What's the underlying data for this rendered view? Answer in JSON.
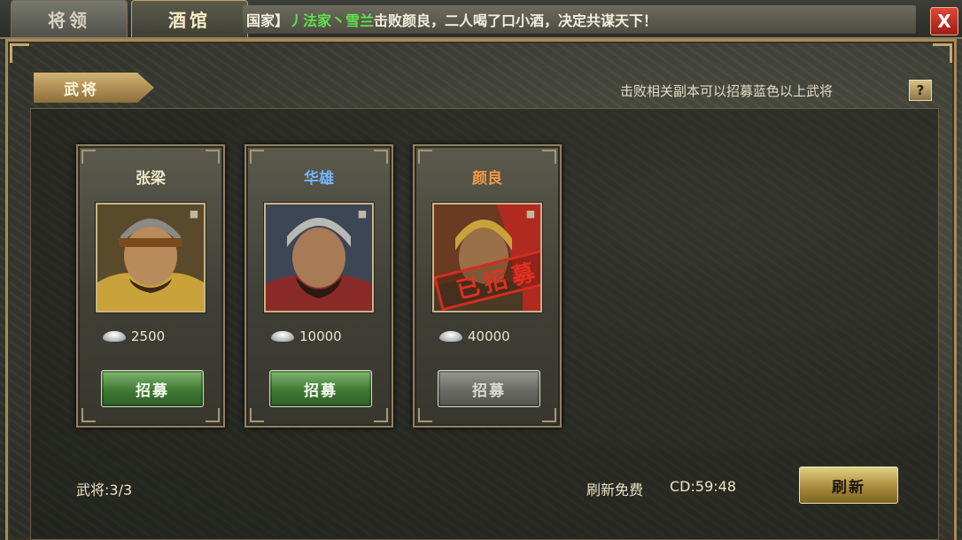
{
  "tabs": [
    {
      "label": "将领",
      "active": false
    },
    {
      "label": "酒馆",
      "active": true
    }
  ],
  "ticker": {
    "prefix": "国家】 ",
    "names": "丿法家丶雪兰",
    "message": "击败颜良，二人喝了口小酒，决定共谋天下！"
  },
  "close_label": "X",
  "section": {
    "label": "武将",
    "hint": "击败相关副本可以招募蓝色以上武将",
    "help_label": "?"
  },
  "generals": [
    {
      "name": "张梁",
      "cost": "2500",
      "button": "招募",
      "recruited": false,
      "name_color": "#f0e6c8"
    },
    {
      "name": "华雄",
      "cost": "10000",
      "button": "招募",
      "recruited": false,
      "name_color": "#74b4ff"
    },
    {
      "name": "颜良",
      "cost": "40000",
      "button": "招募",
      "recruited": true,
      "stamp": "已招募",
      "name_color": "#f39a45"
    }
  ],
  "footer": {
    "count": "武将:3/3",
    "refresh_free": "刷新免费",
    "cd": "CD:59:48",
    "refresh_button": "刷新"
  },
  "colors": {
    "frame_gold": "#a48a5c",
    "button_green": "#3f7a35",
    "stamp_red": "#d52c1e",
    "ticker_green": "#5fe04e"
  }
}
